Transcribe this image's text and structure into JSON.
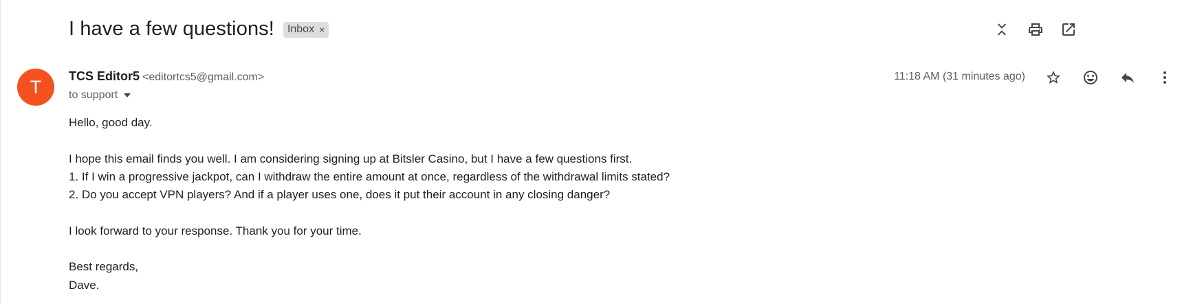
{
  "subject": "I have a few questions!",
  "label_chip": {
    "text": "Inbox",
    "remove": "×"
  },
  "sender": {
    "initial": "T",
    "name": "TCS Editor5",
    "email": "<editortcs5@gmail.com>",
    "recipient": "to support",
    "timestamp": "11:18 AM (31 minutes ago)",
    "avatar_color": "#f4511e"
  },
  "top_icons": [
    "collapse-all-icon",
    "print-icon",
    "open-in-new-window-icon"
  ],
  "message_icons": [
    "star-icon",
    "emoji-icon",
    "reply-icon",
    "more-vert-icon"
  ],
  "body": {
    "greeting": "Hello, good day.",
    "line1": "I hope this email finds you well. I am considering signing up at Bitsler Casino, but I have a few questions first.",
    "line2": "1. If I win a progressive jackpot, can I withdraw the entire amount at once, regardless of the withdrawal limits stated?",
    "line3": "2. Do you accept VPN players? And if a player uses one, does it put their account in any closing danger?",
    "line4": "I look forward to your response. Thank you for your time.",
    "signoff": "Best regards,",
    "signature": "Dave."
  }
}
